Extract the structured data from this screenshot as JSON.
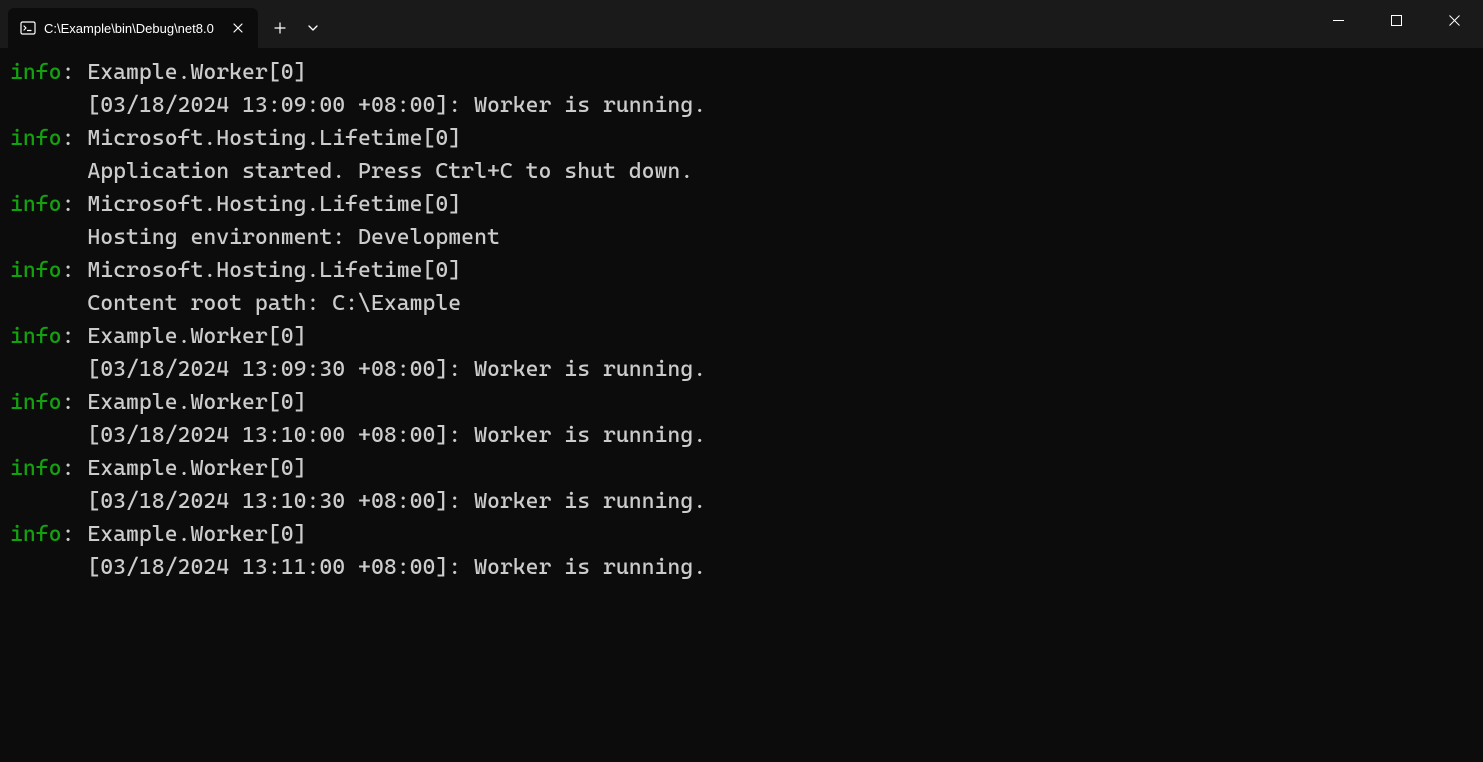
{
  "titlebar": {
    "tab": {
      "title": "C:\\Example\\bin\\Debug\\net8.0"
    }
  },
  "colors": {
    "info_level": "#13a10e",
    "text": "#cccccc",
    "background": "#0c0c0c"
  },
  "logs": [
    {
      "level": "info",
      "category": "Example.Worker[0]",
      "message": "[03/18/2024 13:09:00 +08:00]: Worker is running."
    },
    {
      "level": "info",
      "category": "Microsoft.Hosting.Lifetime[0]",
      "message": "Application started. Press Ctrl+C to shut down."
    },
    {
      "level": "info",
      "category": "Microsoft.Hosting.Lifetime[0]",
      "message": "Hosting environment: Development"
    },
    {
      "level": "info",
      "category": "Microsoft.Hosting.Lifetime[0]",
      "message": "Content root path: C:\\Example"
    },
    {
      "level": "info",
      "category": "Example.Worker[0]",
      "message": "[03/18/2024 13:09:30 +08:00]: Worker is running."
    },
    {
      "level": "info",
      "category": "Example.Worker[0]",
      "message": "[03/18/2024 13:10:00 +08:00]: Worker is running."
    },
    {
      "level": "info",
      "category": "Example.Worker[0]",
      "message": "[03/18/2024 13:10:30 +08:00]: Worker is running."
    },
    {
      "level": "info",
      "category": "Example.Worker[0]",
      "message": "[03/18/2024 13:11:00 +08:00]: Worker is running."
    }
  ]
}
